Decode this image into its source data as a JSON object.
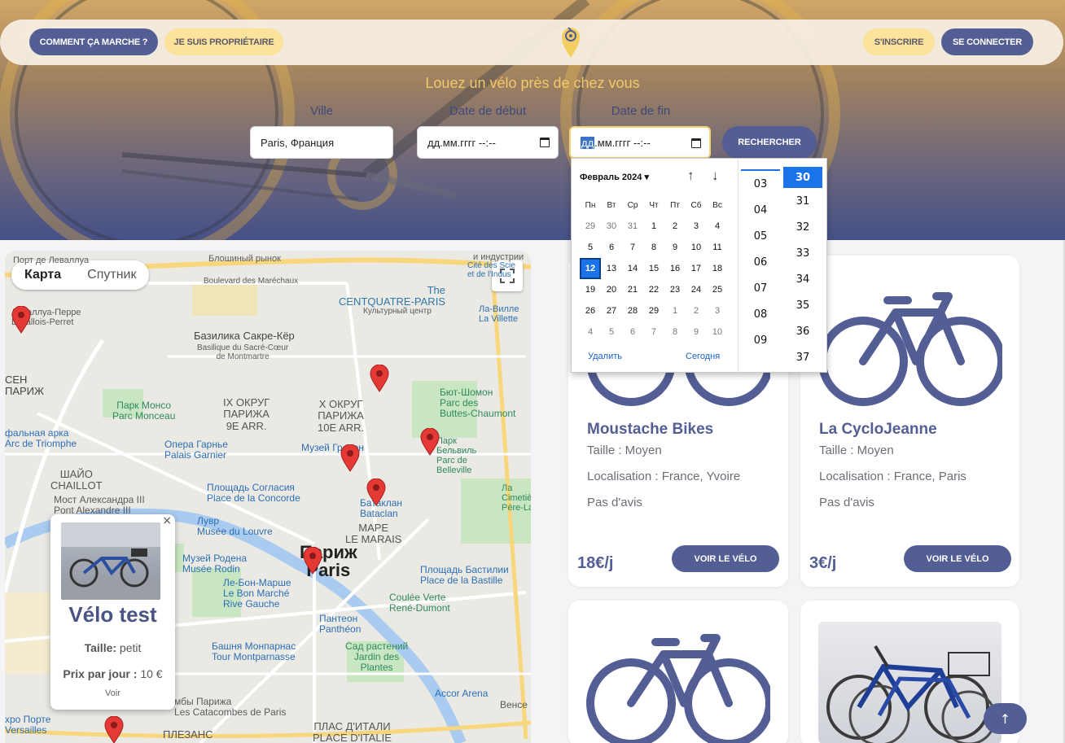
{
  "nav": {
    "how_label": "COMMENT ÇA MARCHE ?",
    "owner_label": "JE SUIS PROPRIÉTAIRE",
    "signup_label": "S'INSCRIRE",
    "login_label": "SE CONNECTER",
    "logo_icon": "bike-pin-logo-icon"
  },
  "hero": {
    "tagline": "Louez un vélo près de chez vous",
    "city_label": "Ville",
    "city_value": "Paris, Франция",
    "start_label": "Date de début",
    "start_value": "дд.мм.гггг --:--",
    "end_label": "Date de fin",
    "end_value_selected": "дд",
    "end_value_rest": ".мм.гггг --:--",
    "search_label": "RECHERCHER"
  },
  "map": {
    "type_map": "Карта",
    "type_satellite": "Спутник",
    "labels": {
      "levallois": "Порт де Леваллуа",
      "levallois_perret": "Леваллуа-Перре\nLevallois-Perret",
      "blochny": "Блошиный рынок",
      "industry": "и индустрии",
      "cite_sci": "Cité des Scie\net de l'Indus",
      "boulevard": "Boulevard des Maréchaux",
      "centquatre": "The\nCENTQUATRE-PARIS",
      "centquatre_sub": "Культурный центр",
      "la_villette": "Ла-Вилле\nLa Villette",
      "sacre": "Базилика Сакре-Кёр",
      "sacre_sub": "Basilique du Sacré-Cœur\nde Montmartre",
      "ix": "IX ОКРУГ\nПАРИЖА\n9E ARR.",
      "x": "X ОКРУГ\nПАРИЖА\n10E ARR.",
      "monceau": "Парк Монсо\nParc Monceau",
      "buttes": "Бют-Шомон\nParc des\nButtes-Chaumont",
      "arc": "фальная арка\nArc de Triomphe",
      "opera": "Опера Гарнье\nPalais Garnier",
      "grevin": "Музей Гревен",
      "belleville": "Парк\nБельвиль\nParc de\nBelleville",
      "chaillot": "ШАЙО\nCHAILLOT",
      "pont_alex": "Мост Александра III\nPont Alexandre III",
      "concorde": "Площадь Согласия\nPlace de la Concorde",
      "bataclan": "Батаклан\nBataclan",
      "louvre": "Лувр\nMusée du Louvre",
      "marais": "МАРЕ\nLE MARAIS",
      "paris_city": "Париж\nParis",
      "rodin": "Музей Родена\nMusée Rodin",
      "bon_marche": "Ле-Бон-Марше\nLe Bon Marché\nRive Gauche",
      "bastille": "Площадь Бастилии\nPlace de la Bastille",
      "coulee": "Coulée Verte\nRené-Dumont",
      "pantheon": "Пантеон\nPanthéon",
      "montparnasse": "Башня Монпарнас\nTour Montparnasse",
      "jardin": "Сад растений\nJardin des\nPlantes",
      "accor": "Accor Arena",
      "catacombs": "мбы Парижа\nLes Catacombes de Paris",
      "versailles": "хро Порте\nVersailles",
      "italie": "ПЛАС Д'ИТАЛИ\nPLACE D'ITALIE",
      "plaisance": "ПЛЕЗАНС",
      "vincennes": "Венсе",
      "cimetiere": "Ла\nCimetiè\nPère-La",
      "seine": "СЕН\nПАРИЖ"
    }
  },
  "popup": {
    "title": "Vélo test",
    "size_label": "Taille:",
    "size_value": "petit",
    "price_label": "Prix par jour :",
    "price_value": "10 €",
    "link": "Voir",
    "close": "×"
  },
  "cards": [
    {
      "title": "Moustache Bikes",
      "size": "Taille : Moyen",
      "location": "Localisation : France, Yvoire",
      "reviews": "Pas d'avis",
      "price": "18€/j",
      "button": "VOIR LE VÉLO"
    },
    {
      "title": "La CycloJeanne",
      "size": "Taille : Moyen",
      "location": "Localisation : France, Paris",
      "reviews": "Pas d'avis",
      "price": "3€/j",
      "button": "VOIR LE VÉLO"
    }
  ],
  "datepicker": {
    "month": "Февраль 2024",
    "weekdays": [
      "Пн",
      "Вт",
      "Ср",
      "Чт",
      "Пт",
      "Сб",
      "Вс"
    ],
    "weeks": [
      [
        "29",
        "30",
        "31",
        "1",
        "2",
        "3",
        "4"
      ],
      [
        "5",
        "6",
        "7",
        "8",
        "9",
        "10",
        "11"
      ],
      [
        "12",
        "13",
        "14",
        "15",
        "16",
        "17",
        "18"
      ],
      [
        "19",
        "20",
        "21",
        "22",
        "23",
        "24",
        "25"
      ],
      [
        "26",
        "27",
        "28",
        "29",
        "1",
        "2",
        "3"
      ],
      [
        "4",
        "5",
        "6",
        "7",
        "8",
        "9",
        "10"
      ]
    ],
    "today": "12",
    "clear": "Удалить",
    "today_label": "Сегодня",
    "hours": [
      "03",
      "04",
      "05",
      "06",
      "07",
      "08",
      "09"
    ],
    "minutes": [
      "30",
      "31",
      "32",
      "33",
      "34",
      "35",
      "36",
      "37"
    ],
    "selected_minute": "30"
  },
  "back_to_top": "↑",
  "colors": {
    "brand_blue": "#535e94",
    "brand_yellow": "#fbe39c",
    "accent_gold": "#f2c96a"
  }
}
